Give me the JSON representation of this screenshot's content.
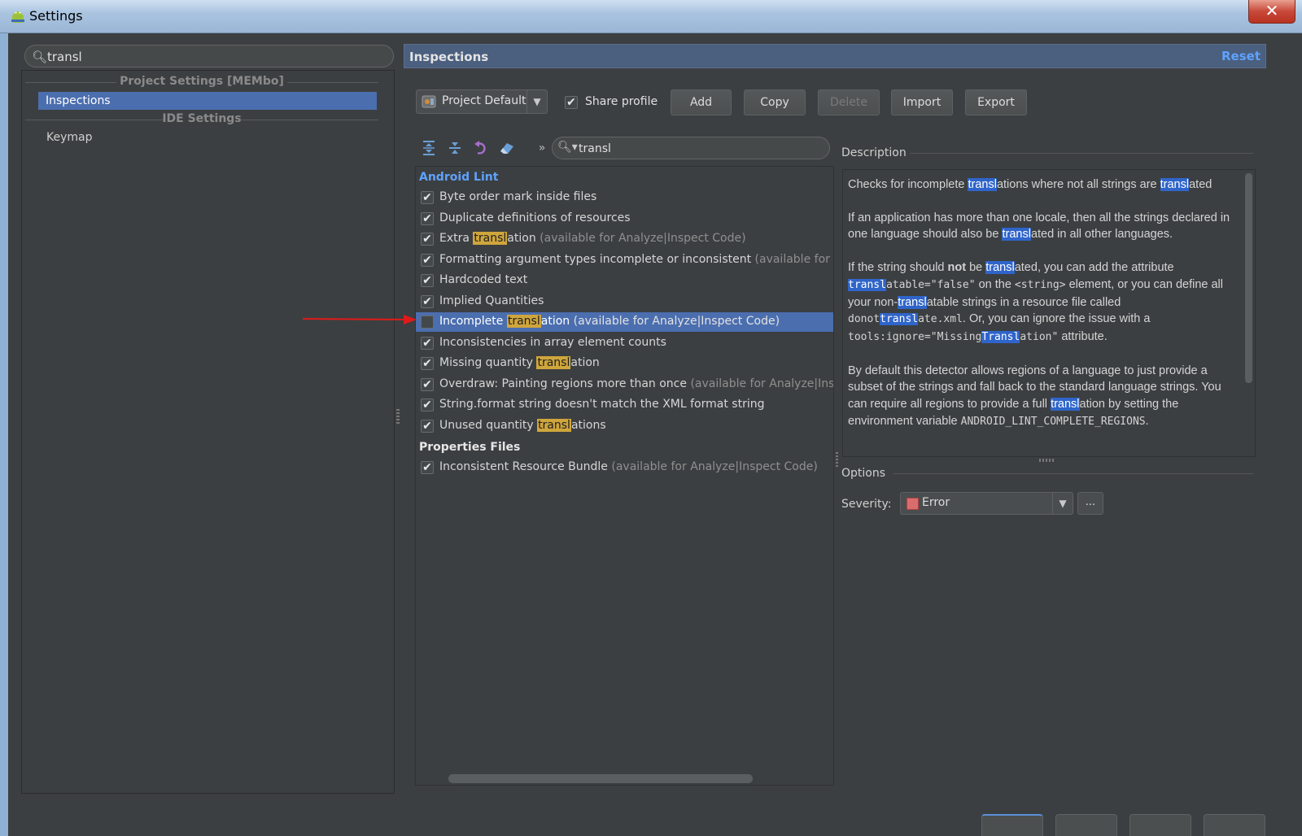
{
  "window": {
    "title": "Settings"
  },
  "left": {
    "search_value": "transl",
    "group_project": "Project Settings [MEMbo]",
    "item_inspections": "Inspections",
    "group_ide": "IDE Settings",
    "item_keymap": "Keymap"
  },
  "right": {
    "title": "Inspections",
    "reset": "Reset",
    "profile": "Project Default",
    "share_profile": "Share profile",
    "buttons": {
      "add": "Add",
      "copy": "Copy",
      "delete": "Delete",
      "import": "Import",
      "export": "Export"
    },
    "filter_value": "transl"
  },
  "tree": {
    "cat_android": "Android Lint",
    "cat_properties": "Properties Files",
    "available_note": "(available for Analyze|Inspect Code)",
    "items": [
      {
        "text": "Byte order mark inside files",
        "checked": true
      },
      {
        "text": "Duplicate definitions of resources",
        "checked": true
      },
      {
        "pre": "Extra ",
        "hl": "transl",
        "post": "ation",
        "note": "(available for Analyze|Inspect Code)",
        "checked": true
      },
      {
        "text": "Formatting argument types incomplete or inconsistent",
        "note": "(available for An",
        "checked": true
      },
      {
        "text": "Hardcoded text",
        "checked": true
      },
      {
        "text": "Implied Quantities",
        "checked": true
      },
      {
        "pre": "Incomplete ",
        "hl": "transl",
        "post": "ation",
        "note": "(available for Analyze|Inspect Code)",
        "checked": false,
        "selected": true
      },
      {
        "text": "Inconsistencies in array element counts",
        "checked": true
      },
      {
        "pre": "Missing quantity ",
        "hl": "transl",
        "post": "ation",
        "checked": true
      },
      {
        "text": "Overdraw: Painting regions more than once",
        "note": "(available for Analyze|Inspec",
        "checked": true
      },
      {
        "text": "String.format string doesn't match the XML format string",
        "checked": true
      },
      {
        "pre": "Unused quantity ",
        "hl": "transl",
        "post": "ations",
        "checked": true
      },
      {
        "text": "Inconsistent Resource Bundle",
        "note": "(available for Analyze|Inspect Code)",
        "checked": true
      }
    ]
  },
  "description": {
    "title": "Description",
    "p1": {
      "a": "Checks for incomplete ",
      "h1": "transl",
      "b": "ations where not all strings are ",
      "h2": "transl",
      "c": "ated"
    },
    "p2": {
      "a": "If an application has more than one locale, then all the strings declared in one language should also be ",
      "h": "transl",
      "b": "ated in all other languages."
    },
    "p3": {
      "a": "If the string should ",
      "not": "not",
      "b": " be ",
      "h1": "transl",
      "c": "ated, you can add the attribute ",
      "h2": "transl",
      "code1": "atable=\"false\"",
      "d": " on the ",
      "code2": "<string>",
      "e": " element, or you can define all your non-",
      "h3": "transl",
      "f": "atable strings in a resource file called ",
      "code3a": "donot",
      "h4": "transl",
      "code3b": "ate.xml",
      "g": ". Or, you can ignore the issue with a ",
      "code4a": "tools:ignore=\"Missing",
      "h5": "Transl",
      "code4b": "ation\"",
      "h": " attribute."
    },
    "p4": {
      "a": "By default this detector allows regions of a language to just provide a subset of the strings and fall back to the standard language strings. You can require all regions to provide a full ",
      "h": "transl",
      "b": "ation by setting the environment variable ",
      "code": "ANDROID_LINT_COMPLETE_REGIONS",
      "c": "."
    }
  },
  "options": {
    "title": "Options",
    "severity_label": "Severity:",
    "severity_value": "Error",
    "more": "..."
  },
  "colors": {
    "highlight_tree": "#cfa63c",
    "highlight_desc": "#2f65ca",
    "selection": "#4b6eaf",
    "category": "#5fa2ff",
    "error_swatch": "#d96d6d",
    "annotation_arrow": "#e01a1a"
  }
}
